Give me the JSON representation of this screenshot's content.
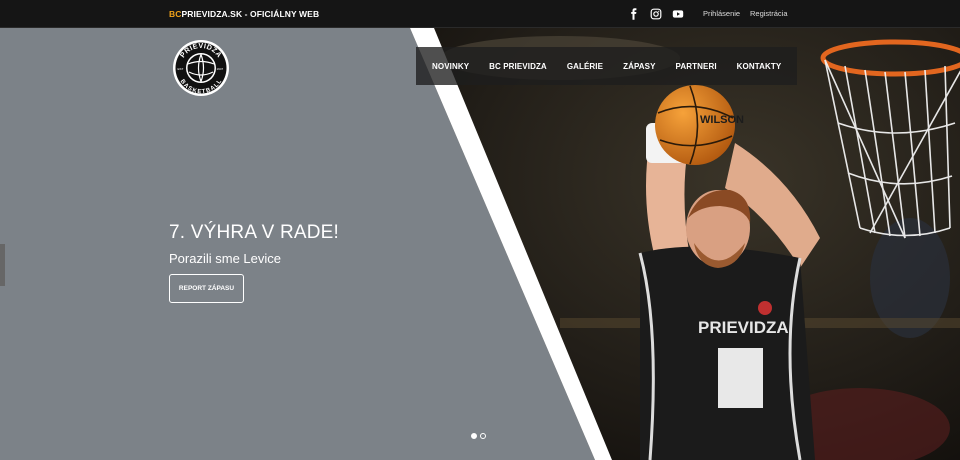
{
  "topbar": {
    "brand_accent": "BC",
    "brand_rest": "PRIEVIDZA.SK - OFICIÁLNY WEB",
    "social": [
      "facebook-icon",
      "instagram-icon",
      "youtube-icon"
    ],
    "login": "Prihlásenie",
    "register": "Registrácia"
  },
  "logo": {
    "top_text": "PRIEVIDZA",
    "bottom_text": "BASKETBALL",
    "left_text": "EST",
    "right_text": "1947"
  },
  "nav": {
    "items": [
      "NOVINKY",
      "BC PRIEVIDZA",
      "GALÉRIE",
      "ZÁPASY",
      "PARTNERI",
      "KONTAKTY"
    ]
  },
  "slide": {
    "title": "7. VÝHRA V RADE!",
    "subtitle": "Porazili sme Levice",
    "button": "REPORT ZÁPASU",
    "jersey_text": "PRIEVIDZA",
    "ball_text": "WILSON"
  },
  "carousel": {
    "count": 2,
    "active": 0
  },
  "colors": {
    "accent": "#f0a21a",
    "panel": "#7c8288",
    "topbar": "#151515"
  }
}
